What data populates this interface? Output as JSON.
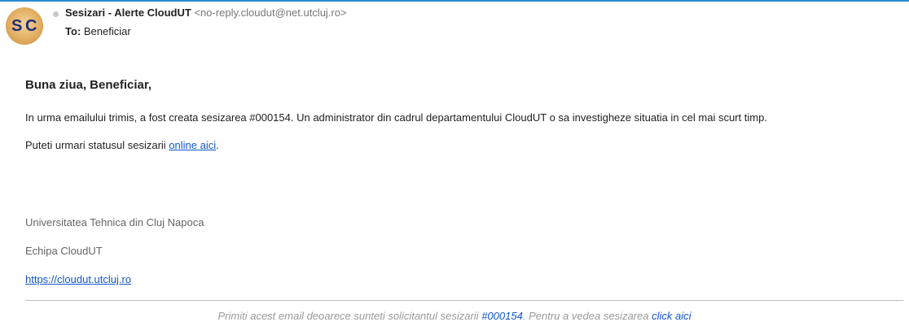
{
  "header": {
    "avatar_letters": {
      "first": "S",
      "second": "C"
    },
    "sender_name": "Sesizari - Alerte CloudUT",
    "sender_email": "<no-reply.cloudut@net.utcluj.ro>",
    "to_label": "To:",
    "to_value": "Beneficiar"
  },
  "body": {
    "greeting": "Buna ziua, Beneficiar,",
    "paragraph1": "In urma emailului trimis, a fost creata sesizarea #000154. Un administrator din cadrul departamentului CloudUT o sa investigheze situatia in cel mai scurt timp.",
    "paragraph2_prefix": "Puteti urmari statusul sesizarii ",
    "paragraph2_link": "online aici",
    "paragraph2_suffix": "."
  },
  "signature": {
    "line1": "Universitatea Tehnica din Cluj Napoca",
    "line2": "Echipa CloudUT",
    "link": "https://cloudut.utcluj.ro"
  },
  "footer": {
    "prefix": "Primiti acest email deoarece sunteti solicitantul sesizarii ",
    "ticket_link": "#000154",
    "middle": ". Pentru a vedea sesizarea ",
    "view_link": "click aici"
  },
  "colors": {
    "accent": "#2a8ad4",
    "link": "#1155cc"
  }
}
